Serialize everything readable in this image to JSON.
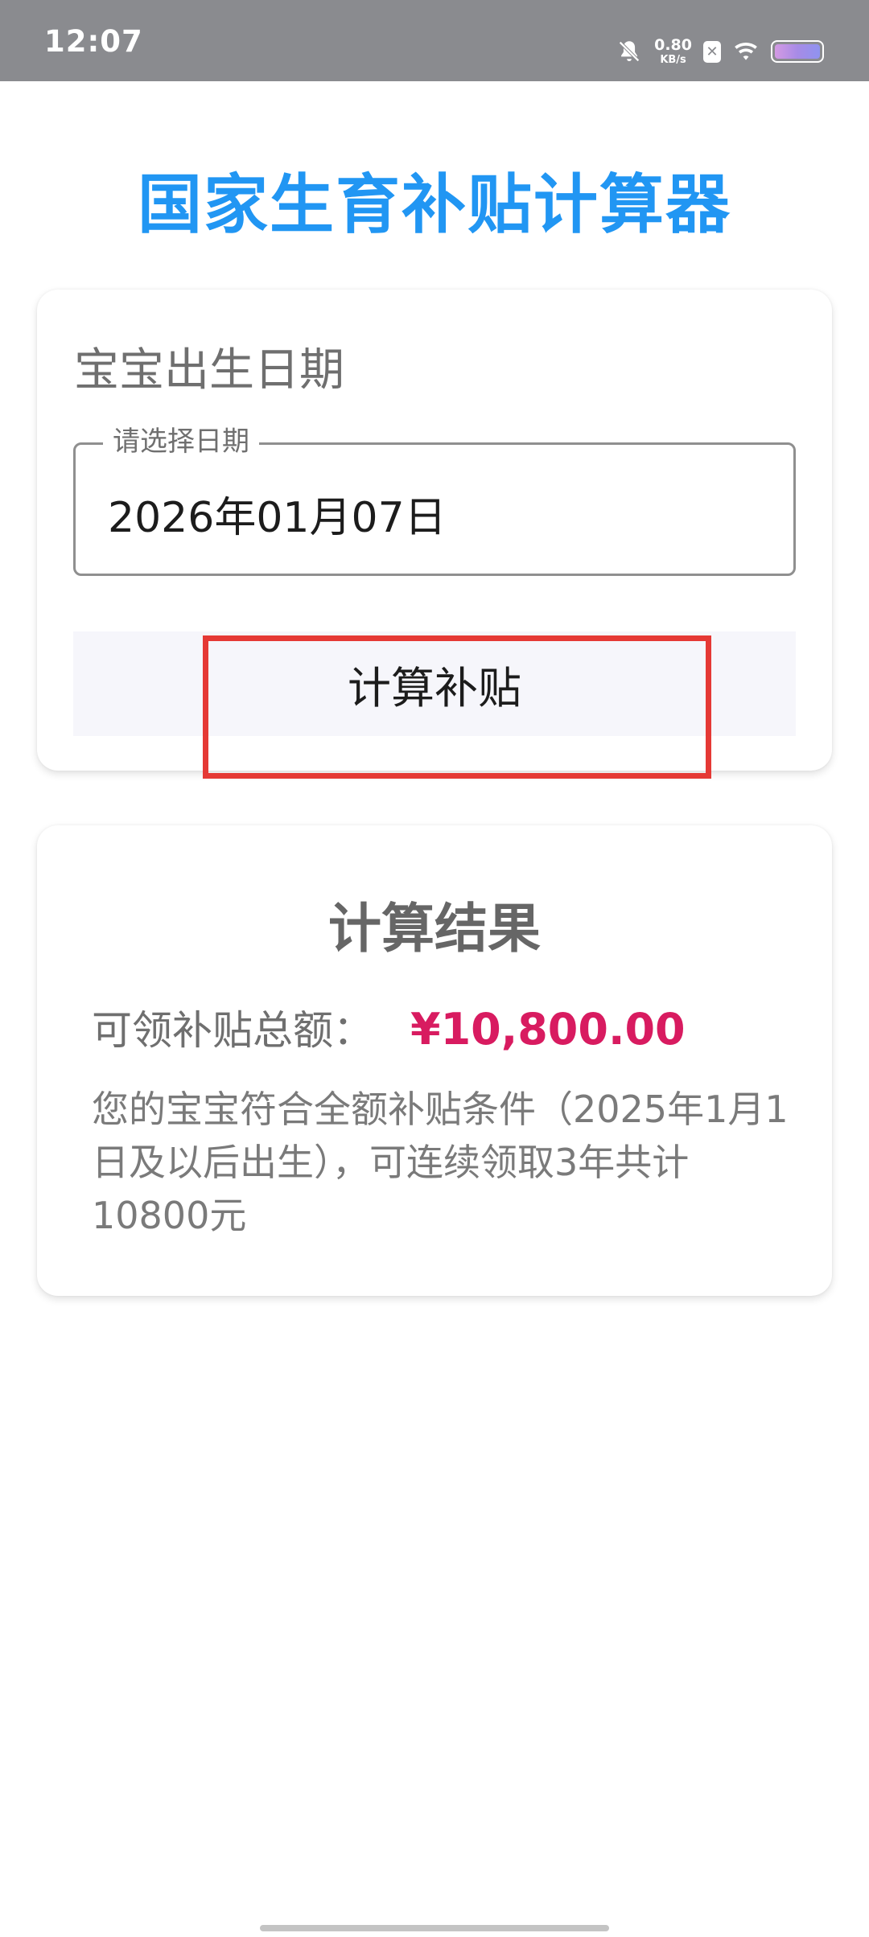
{
  "status_bar": {
    "time": "12:07",
    "net_speed_value": "0.80",
    "net_speed_unit": "KB/s",
    "icons": [
      "bell-muted-icon",
      "sim-icon",
      "wifi-icon",
      "battery-icon"
    ]
  },
  "app": {
    "title": "国家生育补贴计算器",
    "title_color": "#2196f3"
  },
  "date_card": {
    "label": "宝宝出生日期",
    "field_label": "请选择日期",
    "field_value": "2026年01月07日",
    "button_label": "计算补贴"
  },
  "result_card": {
    "title": "计算结果",
    "amount_label": "可领补贴总额：",
    "amount_value": "¥10,800.00",
    "amount_color": "#d81b60",
    "description": "您的宝宝符合全额补贴条件（2025年1月1日及以后出生），可连续领取3年共计10800元"
  },
  "highlight": {
    "color": "#e53935",
    "target": "计算补贴"
  }
}
